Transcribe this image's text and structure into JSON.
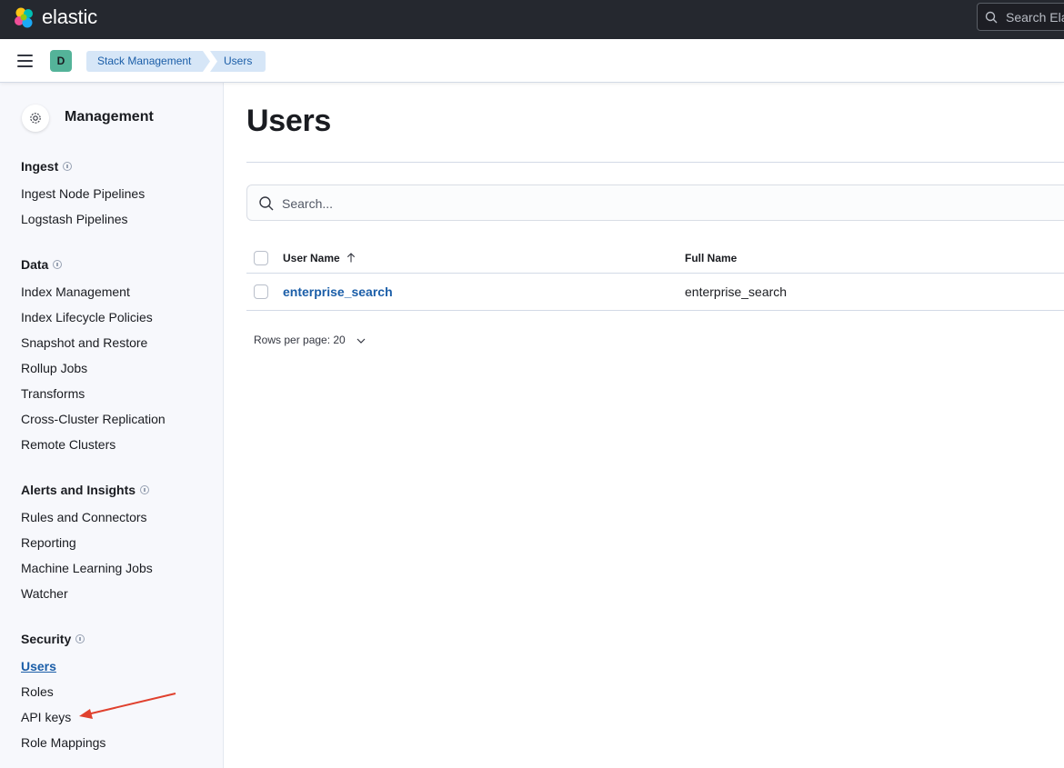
{
  "header": {
    "brand": "elastic",
    "search_placeholder": "Search Ela"
  },
  "breadcrumbs": {
    "space_initial": "D",
    "items": [
      "Stack Management",
      "Users"
    ]
  },
  "sidebar": {
    "title": "Management",
    "sections": [
      {
        "title": "Ingest",
        "items": [
          "Ingest Node Pipelines",
          "Logstash Pipelines"
        ]
      },
      {
        "title": "Data",
        "items": [
          "Index Management",
          "Index Lifecycle Policies",
          "Snapshot and Restore",
          "Rollup Jobs",
          "Transforms",
          "Cross-Cluster Replication",
          "Remote Clusters"
        ]
      },
      {
        "title": "Alerts and Insights",
        "items": [
          "Rules and Connectors",
          "Reporting",
          "Machine Learning Jobs",
          "Watcher"
        ]
      },
      {
        "title": "Security",
        "items": [
          "Users",
          "Roles",
          "API keys",
          "Role Mappings"
        ]
      }
    ],
    "active_item": "Users"
  },
  "main": {
    "title": "Users",
    "search_placeholder": "Search...",
    "columns": [
      "User Name",
      "Full Name"
    ],
    "rows": [
      {
        "user_name": "enterprise_search",
        "full_name": "enterprise_search"
      }
    ],
    "rows_per_page": "Rows per page: 20"
  },
  "colors": {
    "header_bg": "#25282f",
    "link": "#1b5ea8",
    "breadcrumb_bg": "#d6e6f7",
    "space_avatar": "#54b399",
    "annotation_arrow": "#e0412e"
  }
}
